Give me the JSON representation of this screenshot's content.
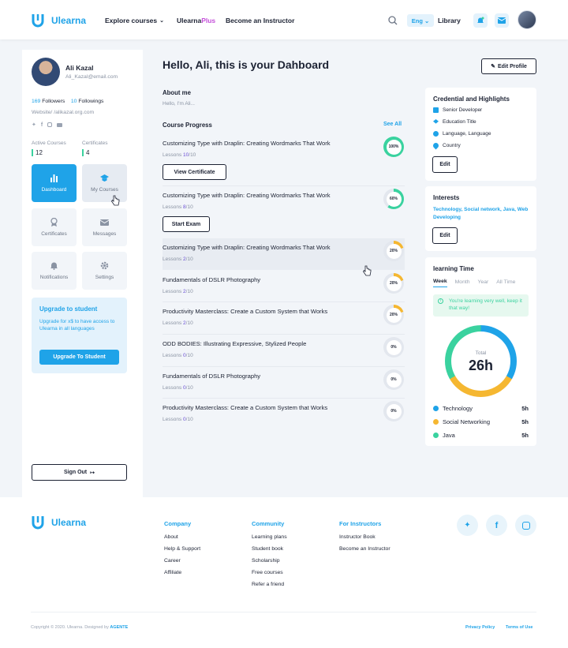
{
  "header": {
    "logo_text": "Ulearna",
    "nav_explore": "Explore courses",
    "nav_plus_a": "Ulearna",
    "nav_plus_b": "Plus",
    "nav_instructor": "Become an Instructor",
    "lang": "Eng",
    "library": "Library"
  },
  "profile": {
    "name": "Ali Kazal",
    "email": "Ali_Kazal@email.com",
    "followers_count": "169",
    "followers_label": "Followers",
    "followings_count": "10",
    "followings_label": "Followings",
    "website": "Website/ /alikazal.org.com",
    "active_courses_label": "Active Courses",
    "active_courses_value": "12",
    "certificates_label": "Certificates",
    "certificates_value": "4"
  },
  "sidebar": {
    "tiles": [
      {
        "label": "Dashboard",
        "icon": "bar-chart-icon"
      },
      {
        "label": "My Courses",
        "icon": "graduation-cap-icon"
      },
      {
        "label": "Certificates",
        "icon": "award-icon"
      },
      {
        "label": "Messages",
        "icon": "envelope-icon"
      },
      {
        "label": "Notifications",
        "icon": "bell-icon"
      },
      {
        "label": "Settings",
        "icon": "gear-icon"
      }
    ],
    "upgrade_title": "Upgrade to student",
    "upgrade_text": "Upgrade for x$ to have access to Ulearna in all languages",
    "upgrade_button": "Upgrade To Student",
    "sign_out": "Sign Out"
  },
  "main": {
    "greeting": "Hello, Ali, this is your Dahboard",
    "edit_profile": "Edit Profile",
    "about_title": "About me",
    "about_text": "Hello, I'm Ali...",
    "progress_title": "Course Progress",
    "see_all": "See All",
    "lessons_label": "Lessons",
    "courses": [
      {
        "title": "Customizing Type with Draplin: Creating Wordmarks That Work",
        "done": "10",
        "total": "/10",
        "percent": 100,
        "percent_label": "100%",
        "action": "View Certificate"
      },
      {
        "title": "Customizing Type with Draplin: Creating Wordmarks That Work",
        "done": "8",
        "total": "/10",
        "percent": 60,
        "percent_label": "60%",
        "action": "Start Exam"
      },
      {
        "title": "Customizing Type with Draplin: Creating Wordmarks That Work",
        "done": "2",
        "total": "/10",
        "percent": 20,
        "percent_label": "20%"
      },
      {
        "title": "Fundamentals of DSLR Photography",
        "done": "2",
        "total": "/10",
        "percent": 20,
        "percent_label": "20%"
      },
      {
        "title": "Productivity Masterclass: Create a Custom System that Works",
        "done": "2",
        "total": "/10",
        "percent": 20,
        "percent_label": "20%"
      },
      {
        "title": "ODD BODIES: Illustrating Expressive, Stylized People",
        "done": "0",
        "total": "/10",
        "percent": 0,
        "percent_label": "0%"
      },
      {
        "title": "Fundamentals of DSLR Photography",
        "done": "0",
        "total": "/10",
        "percent": 0,
        "percent_label": "0%"
      },
      {
        "title": "Productivity Masterclass: Create a Custom System that Works",
        "done": "0",
        "total": "/10",
        "percent": 0,
        "percent_label": "0%"
      }
    ]
  },
  "credentials": {
    "title": "Credential and Highlights",
    "items": [
      {
        "label": "Senior Developer",
        "icon": "monitor-icon"
      },
      {
        "label": "Education Title",
        "icon": "graduation-cap-icon"
      },
      {
        "label": "Language, Language",
        "icon": "globe-icon"
      },
      {
        "label": "Country",
        "icon": "location-pin-icon"
      }
    ],
    "edit": "Edit"
  },
  "interests": {
    "title": "Interests",
    "tags": [
      "Technology,",
      "Social network,",
      "Java,",
      "Web Developing"
    ],
    "edit": "Edit"
  },
  "learning_time": {
    "title": "learning Time",
    "tabs": [
      "Week",
      "Month",
      "Year",
      "All Time"
    ],
    "alert": "You're learning very well, keep it that way!",
    "total_label": "Total",
    "total_value": "26h",
    "items": [
      {
        "label": "Technology",
        "value": "5h",
        "color": "#f5b731"
      },
      {
        "label": "Social Networking",
        "value": "5h",
        "color": "#3ad29f"
      },
      {
        "label": "Java",
        "value": "5h",
        "color": "#1fa3e8"
      }
    ],
    "legend_colors": [
      "#1fa3e8",
      "#f5b731",
      "#3ad29f"
    ]
  },
  "footer": {
    "logo_text": "Ulearna",
    "company_title": "Company",
    "company_links": [
      "About",
      "Help & Support",
      "Career",
      "Affiliate"
    ],
    "community_title": "Community",
    "community_links": [
      "Learning plans",
      "Student book",
      "Scholarship",
      "Free courses",
      "Refer a friend"
    ],
    "instructors_title": "For Instructors",
    "instructors_links": [
      "Instructor Book",
      "Become an Instructor"
    ],
    "copyright": "Copyright © 2020. Ulearna. Designed by",
    "designer": "AGENTE",
    "privacy": "Privacy Policy",
    "terms": "Terms of Use"
  },
  "colors": {
    "accent": "#1fa3e8",
    "purple": "#6a4fd6",
    "green": "#3ad29f",
    "orange": "#f5b731"
  }
}
